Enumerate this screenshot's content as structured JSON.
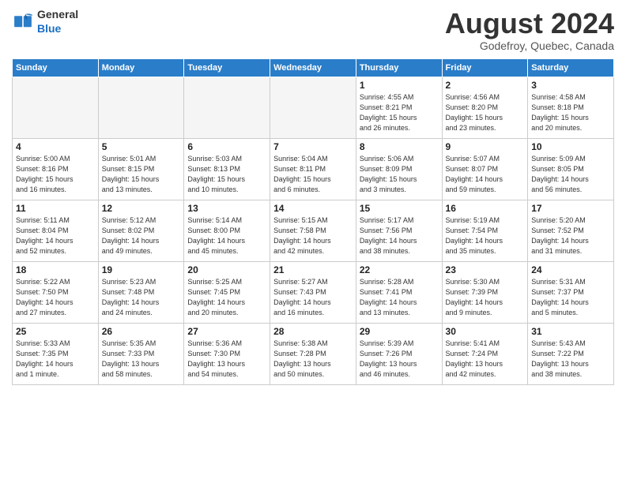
{
  "logo": {
    "general": "General",
    "blue": "Blue"
  },
  "header": {
    "month": "August 2024",
    "location": "Godefroy, Quebec, Canada"
  },
  "days_of_week": [
    "Sunday",
    "Monday",
    "Tuesday",
    "Wednesday",
    "Thursday",
    "Friday",
    "Saturday"
  ],
  "weeks": [
    [
      {
        "day": "",
        "info": ""
      },
      {
        "day": "",
        "info": ""
      },
      {
        "day": "",
        "info": ""
      },
      {
        "day": "",
        "info": ""
      },
      {
        "day": "1",
        "info": "Sunrise: 4:55 AM\nSunset: 8:21 PM\nDaylight: 15 hours\nand 26 minutes."
      },
      {
        "day": "2",
        "info": "Sunrise: 4:56 AM\nSunset: 8:20 PM\nDaylight: 15 hours\nand 23 minutes."
      },
      {
        "day": "3",
        "info": "Sunrise: 4:58 AM\nSunset: 8:18 PM\nDaylight: 15 hours\nand 20 minutes."
      }
    ],
    [
      {
        "day": "4",
        "info": "Sunrise: 5:00 AM\nSunset: 8:16 PM\nDaylight: 15 hours\nand 16 minutes."
      },
      {
        "day": "5",
        "info": "Sunrise: 5:01 AM\nSunset: 8:15 PM\nDaylight: 15 hours\nand 13 minutes."
      },
      {
        "day": "6",
        "info": "Sunrise: 5:03 AM\nSunset: 8:13 PM\nDaylight: 15 hours\nand 10 minutes."
      },
      {
        "day": "7",
        "info": "Sunrise: 5:04 AM\nSunset: 8:11 PM\nDaylight: 15 hours\nand 6 minutes."
      },
      {
        "day": "8",
        "info": "Sunrise: 5:06 AM\nSunset: 8:09 PM\nDaylight: 15 hours\nand 3 minutes."
      },
      {
        "day": "9",
        "info": "Sunrise: 5:07 AM\nSunset: 8:07 PM\nDaylight: 14 hours\nand 59 minutes."
      },
      {
        "day": "10",
        "info": "Sunrise: 5:09 AM\nSunset: 8:05 PM\nDaylight: 14 hours\nand 56 minutes."
      }
    ],
    [
      {
        "day": "11",
        "info": "Sunrise: 5:11 AM\nSunset: 8:04 PM\nDaylight: 14 hours\nand 52 minutes."
      },
      {
        "day": "12",
        "info": "Sunrise: 5:12 AM\nSunset: 8:02 PM\nDaylight: 14 hours\nand 49 minutes."
      },
      {
        "day": "13",
        "info": "Sunrise: 5:14 AM\nSunset: 8:00 PM\nDaylight: 14 hours\nand 45 minutes."
      },
      {
        "day": "14",
        "info": "Sunrise: 5:15 AM\nSunset: 7:58 PM\nDaylight: 14 hours\nand 42 minutes."
      },
      {
        "day": "15",
        "info": "Sunrise: 5:17 AM\nSunset: 7:56 PM\nDaylight: 14 hours\nand 38 minutes."
      },
      {
        "day": "16",
        "info": "Sunrise: 5:19 AM\nSunset: 7:54 PM\nDaylight: 14 hours\nand 35 minutes."
      },
      {
        "day": "17",
        "info": "Sunrise: 5:20 AM\nSunset: 7:52 PM\nDaylight: 14 hours\nand 31 minutes."
      }
    ],
    [
      {
        "day": "18",
        "info": "Sunrise: 5:22 AM\nSunset: 7:50 PM\nDaylight: 14 hours\nand 27 minutes."
      },
      {
        "day": "19",
        "info": "Sunrise: 5:23 AM\nSunset: 7:48 PM\nDaylight: 14 hours\nand 24 minutes."
      },
      {
        "day": "20",
        "info": "Sunrise: 5:25 AM\nSunset: 7:45 PM\nDaylight: 14 hours\nand 20 minutes."
      },
      {
        "day": "21",
        "info": "Sunrise: 5:27 AM\nSunset: 7:43 PM\nDaylight: 14 hours\nand 16 minutes."
      },
      {
        "day": "22",
        "info": "Sunrise: 5:28 AM\nSunset: 7:41 PM\nDaylight: 14 hours\nand 13 minutes."
      },
      {
        "day": "23",
        "info": "Sunrise: 5:30 AM\nSunset: 7:39 PM\nDaylight: 14 hours\nand 9 minutes."
      },
      {
        "day": "24",
        "info": "Sunrise: 5:31 AM\nSunset: 7:37 PM\nDaylight: 14 hours\nand 5 minutes."
      }
    ],
    [
      {
        "day": "25",
        "info": "Sunrise: 5:33 AM\nSunset: 7:35 PM\nDaylight: 14 hours\nand 1 minute."
      },
      {
        "day": "26",
        "info": "Sunrise: 5:35 AM\nSunset: 7:33 PM\nDaylight: 13 hours\nand 58 minutes."
      },
      {
        "day": "27",
        "info": "Sunrise: 5:36 AM\nSunset: 7:30 PM\nDaylight: 13 hours\nand 54 minutes."
      },
      {
        "day": "28",
        "info": "Sunrise: 5:38 AM\nSunset: 7:28 PM\nDaylight: 13 hours\nand 50 minutes."
      },
      {
        "day": "29",
        "info": "Sunrise: 5:39 AM\nSunset: 7:26 PM\nDaylight: 13 hours\nand 46 minutes."
      },
      {
        "day": "30",
        "info": "Sunrise: 5:41 AM\nSunset: 7:24 PM\nDaylight: 13 hours\nand 42 minutes."
      },
      {
        "day": "31",
        "info": "Sunrise: 5:43 AM\nSunset: 7:22 PM\nDaylight: 13 hours\nand 38 minutes."
      }
    ]
  ]
}
